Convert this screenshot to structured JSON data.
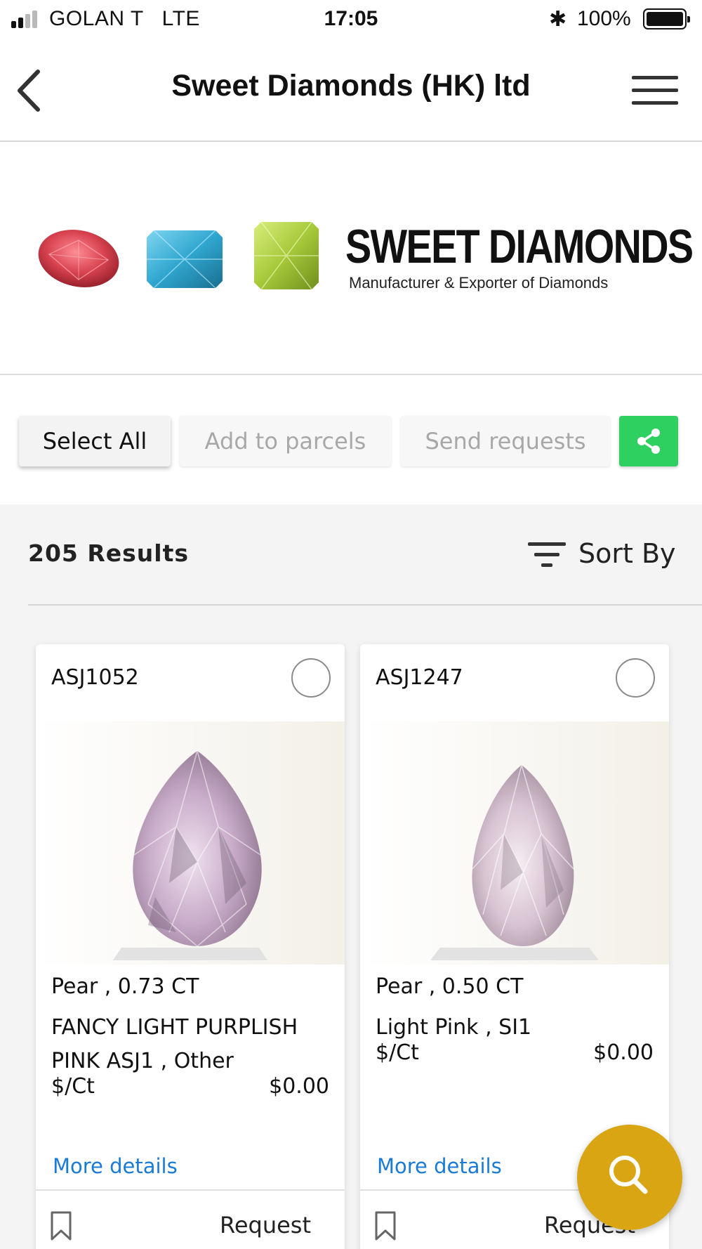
{
  "status_bar": {
    "carrier": "GOLAN T   LTE",
    "time": "17:05",
    "bluetooth": "✱",
    "battery": "100%"
  },
  "header": {
    "title": "Sweet Diamonds (HK) ltd",
    "back_icon": "chevron-left-icon",
    "menu_icon": "hamburger-menu-icon"
  },
  "banner": {
    "brand": "SWEET DIAMONDS",
    "tagline": "Manufacturer & Exporter of Diamonds",
    "gem_colors": [
      "#d8424f",
      "#2fa6cf",
      "#a6c93a"
    ]
  },
  "actions": {
    "select_all": "Select All",
    "add_to_parcels": "Add to parcels",
    "send_requests": "Send requests",
    "share_icon": "share-icon",
    "share_color": "#2ed060"
  },
  "results": {
    "count_label": "205 Results",
    "sort_label": "Sort By",
    "sort_icon": "filter-icon"
  },
  "cards": [
    {
      "id": "ASJ1052",
      "line1": "Pear , 0.73 CT",
      "line2": "FANCY LIGHT PURPLISH PINK ASJ1 , Other",
      "price_label": "$/Ct",
      "price": "$0.00",
      "more": "More details",
      "request": "Request"
    },
    {
      "id": "ASJ1247",
      "line1": "Pear , 0.50 CT",
      "line2": "Light Pink , SI1",
      "price_label": "$/Ct",
      "price": "$0.00",
      "more": "More details",
      "request": "Request"
    }
  ],
  "fab": {
    "icon": "search-icon",
    "color": "#d9a513"
  }
}
